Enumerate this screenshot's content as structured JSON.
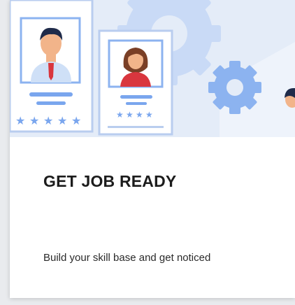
{
  "card": {
    "title": "GET JOB READY",
    "description": "Build your skill base and get noticed",
    "illustration": {
      "icons": [
        "profile-card-icon",
        "gear-icon",
        "person-icon"
      ],
      "accent_color": "#7aa6ee",
      "background_color": "#e4ecf8",
      "card_border_color": "#b9cdef",
      "skin_color": "#f2b48a",
      "shirt_color": "#cfe0f7",
      "tie_color": "#d9363e"
    }
  }
}
